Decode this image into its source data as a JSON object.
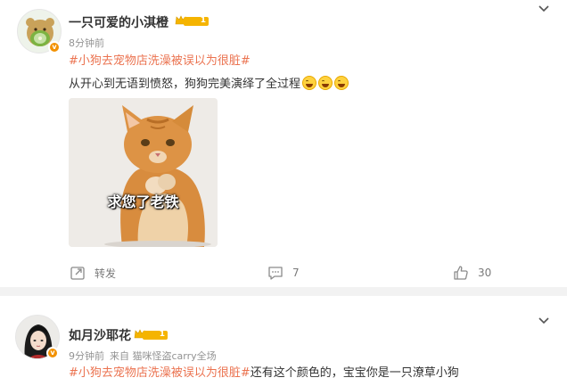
{
  "post1": {
    "username": "一只可爱的小淇橙",
    "level": "1",
    "time": "8分钟前",
    "hashtag": "#小狗去宠物店洗澡被误以为很脏#",
    "body": "从开心到无语到愤怒，狗狗完美演绎了全过程",
    "emoji_count": 3,
    "image_caption": "求您了老铁",
    "repost_label": "转发",
    "comment_count": "7",
    "like_count": "30"
  },
  "post2": {
    "username": "如月沙耶花",
    "level": "1",
    "time": "9分钟前",
    "source": "来自 猫咪怪盗carry全场",
    "hashtag": "#小狗去宠物店洗澡被误以为很脏#",
    "body": "还有这个颜色的，宝宝你是一只潦草小狗"
  },
  "colors": {
    "hashtag": "#eb7350",
    "verified_badge": "#f29100",
    "crown": "#f5b400",
    "meta": "#939393",
    "divider": "#f2f2f2"
  },
  "icons": {
    "repost": "repost-icon",
    "comment": "comment-icon",
    "like": "like-icon",
    "more": "chevron-down-icon"
  }
}
